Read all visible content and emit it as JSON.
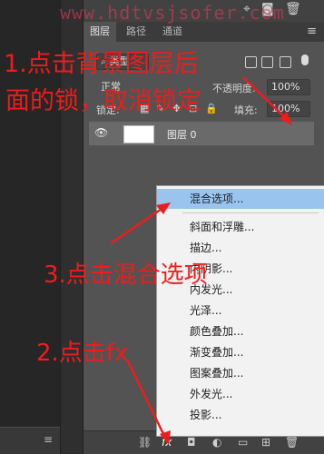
{
  "watermark": "www.hdtvsjsofer.com",
  "panel": {
    "tabs": [
      "图层",
      "路径",
      "通道"
    ],
    "filter_kind": "类型",
    "blend_mode": "正常",
    "opacity_label": "不透明度:",
    "opacity_value": "100%",
    "lock_label": "锁定:",
    "fill_label": "填充:",
    "fill_value": "100%",
    "layer_name": "图层 0",
    "fx_label": "fx"
  },
  "menu": {
    "items": [
      "混合选项...",
      "斜面和浮雕...",
      "描边...",
      "内阴影...",
      "内发光...",
      "光泽...",
      "颜色叠加...",
      "渐变叠加...",
      "图案叠加...",
      "外发光...",
      "投影..."
    ],
    "highlighted_index": 0
  },
  "annotations": {
    "step1_line1": "1.点击背景图层后",
    "step1_line2": "面的锁，取消锁定",
    "step2": "2.点击fx",
    "step3": "3.点击混合选项"
  },
  "colors": {
    "annotation": "#ee1c1c",
    "menu_highlight": "#99c4ee",
    "panel_bg": "#535353"
  },
  "icons": [
    "menu-lines-icon",
    "eye-icon",
    "link-icon",
    "fx-icon",
    "mask-icon",
    "adjustment-icon",
    "folder-icon",
    "new-layer-icon",
    "trash-icon",
    "camera-icon",
    "pin-icon",
    "lock-icon",
    "brush-icon",
    "move-icon",
    "artboard-icon"
  ]
}
